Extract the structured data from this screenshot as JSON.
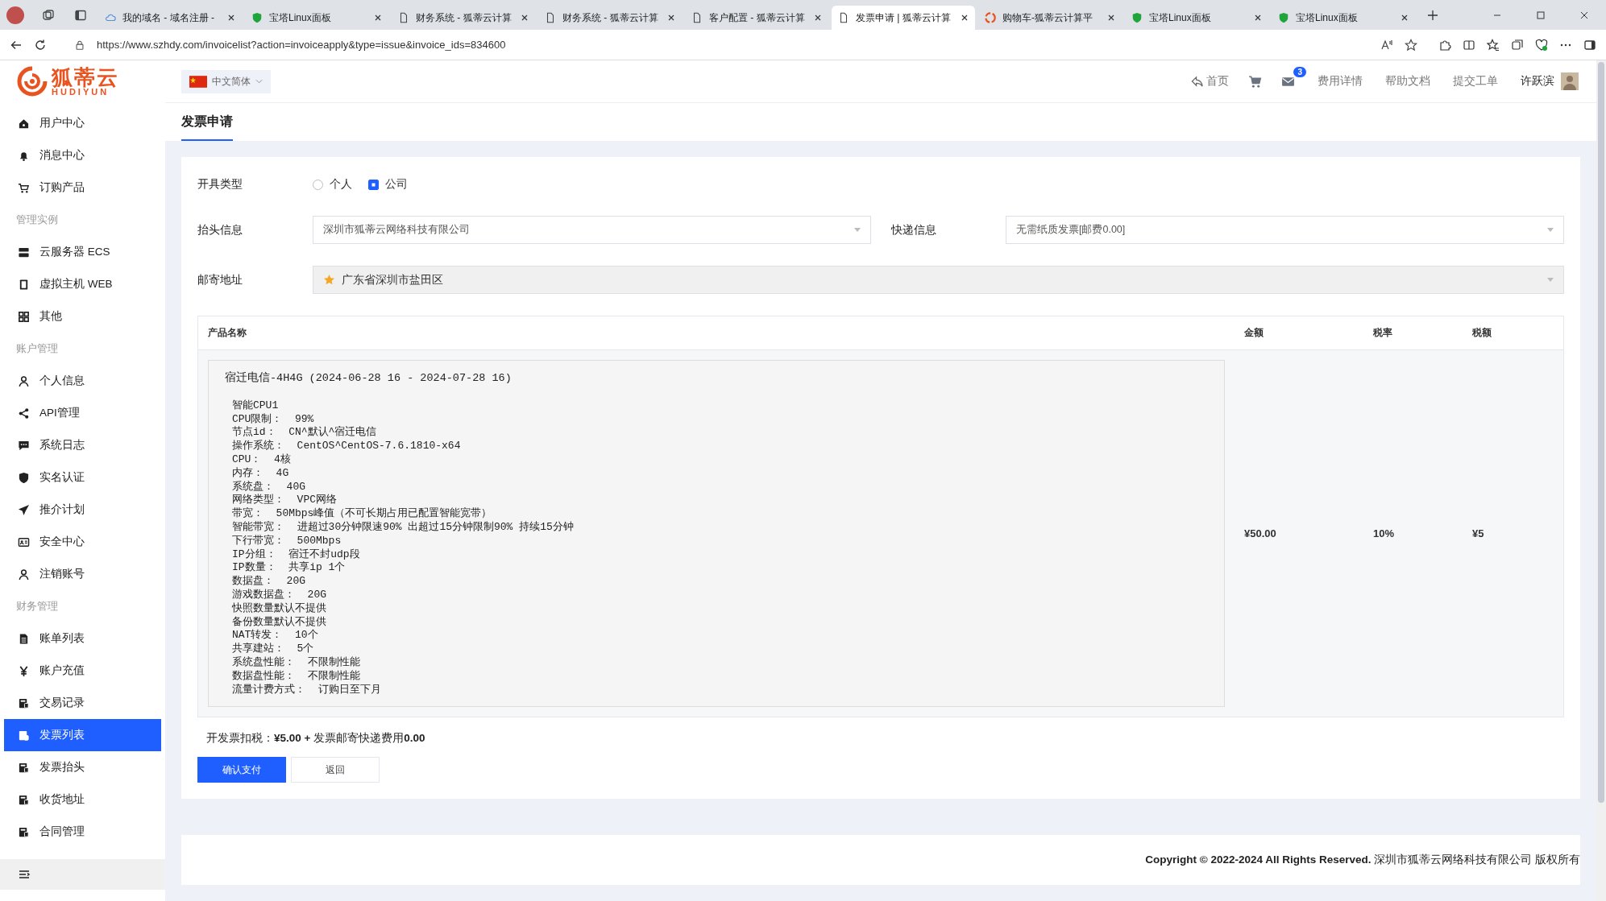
{
  "browser": {
    "tabs": [
      {
        "title": "我的域名 - 域名注册 -",
        "selected": false,
        "kind": "cloud"
      },
      {
        "title": "宝塔Linux面板",
        "selected": false,
        "kind": "shield"
      },
      {
        "title": "财务系统 - 狐蒂云计算",
        "selected": false,
        "kind": "page"
      },
      {
        "title": "财务系统 - 狐蒂云计算",
        "selected": false,
        "kind": "page"
      },
      {
        "title": "客户配置 - 狐蒂云计算",
        "selected": false,
        "kind": "page"
      },
      {
        "title": "发票申请 | 狐蒂云计算",
        "selected": true,
        "kind": "page"
      },
      {
        "title": "购物车-狐蒂云计算平",
        "selected": false,
        "kind": "logo"
      },
      {
        "title": "宝塔Linux面板",
        "selected": false,
        "kind": "shield"
      },
      {
        "title": "宝塔Linux面板",
        "selected": false,
        "kind": "shield"
      }
    ],
    "url": "https://www.szhdy.com/invoicelist?action=invoiceapply&type=issue&invoice_ids=834600"
  },
  "logo": {
    "name": "狐蒂云",
    "subtitle": "HUDIYUN"
  },
  "language": "中文简体",
  "header": {
    "home": "首页",
    "mail_badge": "3",
    "links": [
      "费用详情",
      "帮助文档",
      "提交工单"
    ],
    "user": "许跃滨"
  },
  "sidebar": {
    "items": [
      {
        "kind": "link",
        "label": "用户中心",
        "selected": false
      },
      {
        "kind": "link",
        "label": "消息中心",
        "selected": false
      },
      {
        "kind": "link",
        "label": "订购产品",
        "selected": false
      },
      {
        "kind": "section",
        "label": "管理实例"
      },
      {
        "kind": "link",
        "label": "云服务器 ECS",
        "selected": false
      },
      {
        "kind": "link",
        "label": "虚拟主机 WEB",
        "selected": false
      },
      {
        "kind": "link",
        "label": "其他",
        "selected": false
      },
      {
        "kind": "section",
        "label": "账户管理"
      },
      {
        "kind": "link",
        "label": "个人信息",
        "selected": false
      },
      {
        "kind": "link",
        "label": "API管理",
        "selected": false
      },
      {
        "kind": "link",
        "label": "系统日志",
        "selected": false
      },
      {
        "kind": "link",
        "label": "实名认证",
        "selected": false
      },
      {
        "kind": "link",
        "label": "推介计划",
        "selected": false
      },
      {
        "kind": "link",
        "label": "安全中心",
        "selected": false
      },
      {
        "kind": "link",
        "label": "注销账号",
        "selected": false
      },
      {
        "kind": "section",
        "label": "财务管理"
      },
      {
        "kind": "link",
        "label": "账单列表",
        "selected": false
      },
      {
        "kind": "link",
        "label": "账户充值",
        "selected": false
      },
      {
        "kind": "link",
        "label": "交易记录",
        "selected": false
      },
      {
        "kind": "link",
        "label": "发票列表",
        "selected": true
      },
      {
        "kind": "link",
        "label": "发票抬头",
        "selected": false
      },
      {
        "kind": "link",
        "label": "收货地址",
        "selected": false
      },
      {
        "kind": "link",
        "label": "合同管理",
        "selected": false
      }
    ]
  },
  "page_title": "发票申请",
  "form": {
    "invoice_type": {
      "label": "开具类型",
      "options": [
        {
          "label": "个人",
          "selected": false
        },
        {
          "label": "公司",
          "selected": true
        }
      ]
    },
    "title_info": {
      "label": "抬头信息",
      "value": "深圳市狐蒂云网络科技有限公司"
    },
    "delivery": {
      "label": "快递信息",
      "value": "无需纸质发票[邮费0.00]"
    },
    "address": {
      "label": "邮寄地址",
      "value": "广东省深圳市盐田区"
    }
  },
  "table": {
    "columns": [
      "产品名称",
      "金额",
      "税率",
      "税额"
    ],
    "rows": [
      {
        "title": "宿迁电信-4H4G (2024-06-28 16 - 2024-07-28 16)",
        "details": [
          "智能CPU1",
          "CPU限制：  99%",
          "节点id：  CN^默认^宿迁电信",
          "操作系统：  CentOS^CentOS-7.6.1810-x64",
          "CPU：  4核",
          "内存：  4G",
          "系统盘：  40G",
          "网络类型：  VPC网络",
          "带宽：  50Mbps峰值（不可长期占用已配置智能宽带）",
          "智能带宽：  进超过30分钟限速90% 出超过15分钟限制90% 持续15分钟",
          "下行带宽：  500Mbps",
          "IP分组：  宿迁不封udp段",
          "IP数量：  共享ip 1个",
          "数据盘：  20G",
          "游戏数据盘：  20G",
          "快照数量默认不提供",
          "备份数量默认不提供",
          "NAT转发：  10个",
          "共享建站：  5个",
          "系统盘性能：  不限制性能",
          "数据盘性能：  不限制性能",
          "流量计费方式：  订购日至下月"
        ],
        "amount": "¥50.00",
        "rate": "10%",
        "tax": "¥5"
      }
    ]
  },
  "summary": "开发票扣税：**¥5.00 +** 发票邮寄快递费用**0.00**",
  "buttons": [
    "确认支付",
    "返回"
  ],
  "footer": "**Copyright © 2022-2024 All Rights Reserved.** 深圳市狐蒂云网络科技有限公司 版权所有"
}
